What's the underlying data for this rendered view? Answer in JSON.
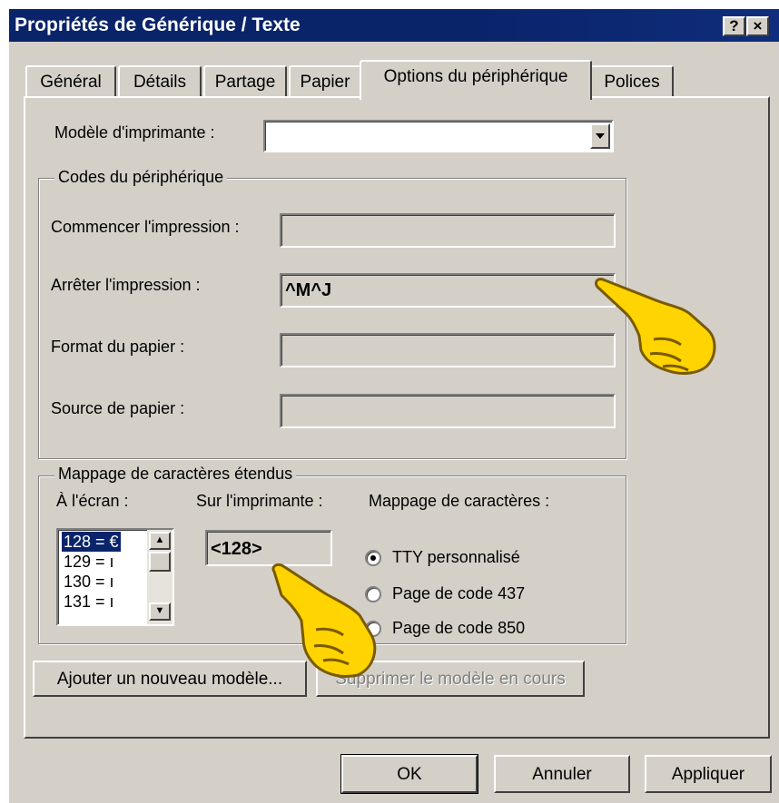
{
  "window": {
    "title": "Propriétés de Générique / Texte",
    "help_btn": "?",
    "close_btn": "×"
  },
  "tabs": [
    "Général",
    "Détails",
    "Partage",
    "Papier",
    "Options du périphérique",
    "Polices"
  ],
  "printer_model": {
    "label": "Modèle d'imprimante :",
    "value": ""
  },
  "device_codes": {
    "legend": "Codes du périphérique",
    "start_label": "Commencer l'impression :",
    "start_value": "",
    "stop_label": "Arrêter l'impression :",
    "stop_value": "^M^J",
    "format_label": "Format du papier :",
    "format_value": "",
    "source_label": "Source de papier :",
    "source_value": ""
  },
  "mapping": {
    "legend": "Mappage de caractères étendus",
    "screen_label": "À l'écran :",
    "printer_label": "Sur l'imprimante :",
    "charmap_label": "Mappage de caractères :",
    "list_items": [
      "128 = €",
      "129 = ı",
      "130 = ı",
      "131 = ı"
    ],
    "printer_value": "<128>",
    "radio_tty": "TTY personnalisé",
    "radio_437": "Page de code 437",
    "radio_850": "Page de code 850"
  },
  "buttons": {
    "add_model": "Ajouter un nouveau modèle...",
    "delete_model": "Supprimer le modèle en cours",
    "ok": "OK",
    "cancel": "Annuler",
    "apply": "Appliquer"
  }
}
